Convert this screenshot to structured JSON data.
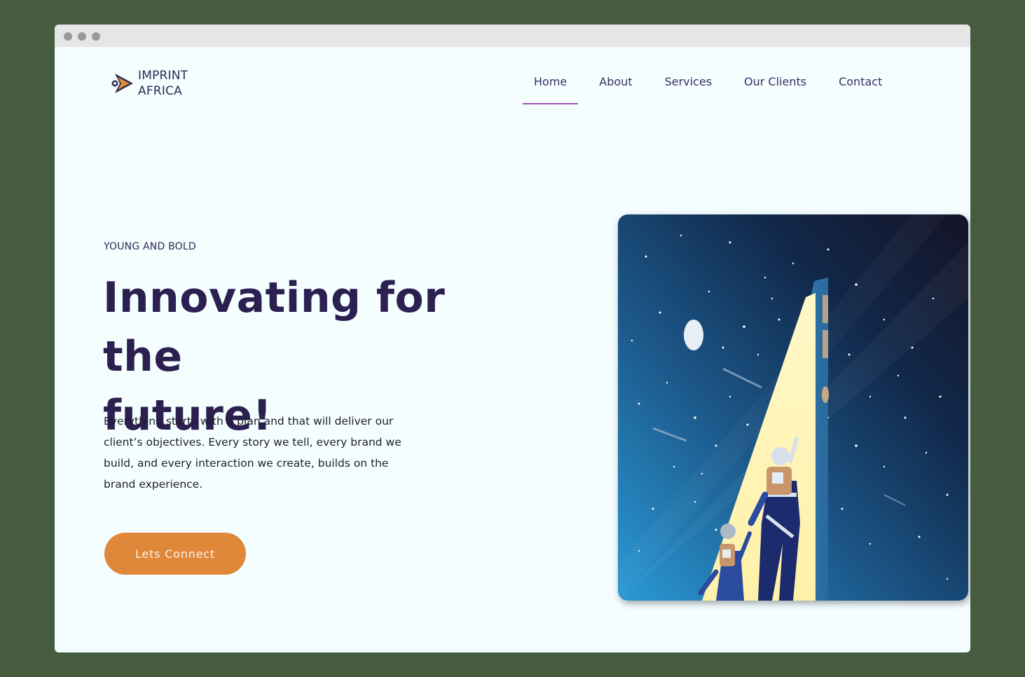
{
  "brand": {
    "name_line1": "IMPRINT",
    "name_line2": "AFRICA",
    "accent_color": "#e0883a",
    "primary_color": "#2b2050",
    "nav_active_color": "#9b5aaf"
  },
  "nav": {
    "items": [
      {
        "label": "Home",
        "active": true
      },
      {
        "label": "About",
        "active": false
      },
      {
        "label": "Services",
        "active": false
      },
      {
        "label": "Our Clients",
        "active": false
      },
      {
        "label": "Contact",
        "active": false
      }
    ]
  },
  "hero": {
    "eyebrow": "YOUNG AND BOLD",
    "headline_line1": "Innovating for the",
    "headline_line2": "future!",
    "body": "Everything starts with a plan and that will deliver our client’s objectives. Every story we tell, every brand we build, and every interaction we create, builds on the brand experience.",
    "cta_label": "Lets Connect"
  }
}
